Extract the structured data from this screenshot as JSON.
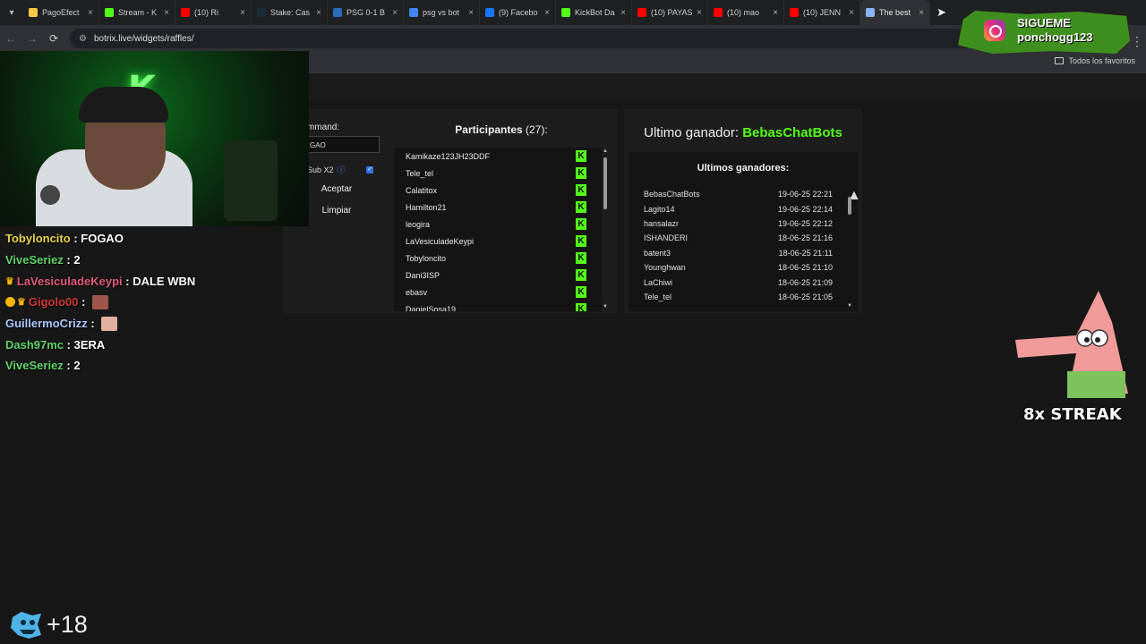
{
  "browser": {
    "tabs": [
      {
        "title": "PagoEfect",
        "color": "#f7c948"
      },
      {
        "title": "Stream - K",
        "color": "#53fc18"
      },
      {
        "title": "(10) Ri",
        "color": "#ff0000"
      },
      {
        "title": "Stake: Cas",
        "color": "#1a2c38"
      },
      {
        "title": "PSG 0-1 B",
        "color": "#2a6ebb"
      },
      {
        "title": "psg vs bot",
        "color": "#4285f4"
      },
      {
        "title": "(9) Facebo",
        "color": "#1877f2"
      },
      {
        "title": "KickBot Da",
        "color": "#53fc18"
      },
      {
        "title": "(10) PAYAS",
        "color": "#ff0000"
      },
      {
        "title": "(10) mao",
        "color": "#ff0000"
      },
      {
        "title": "(10) JENN",
        "color": "#ff0000"
      },
      {
        "title": "The best",
        "color": "#8ab4f8",
        "active": true
      }
    ],
    "url": "botrix.live/widgets/raffles/",
    "bookmarks_all": "Todos los favoritos"
  },
  "raffle": {
    "command_label": "mmand:",
    "command_value": "GAO",
    "sub_label": "Sub X2",
    "accept_label": "Aceptar",
    "clear_label": "Limpiar",
    "participants_title": "Participantes",
    "participants_count": "(27):",
    "participants": [
      "Kamikaze123JH23DDF",
      "Tele_tel",
      "Calatitox",
      "Hamilton21",
      "leogira",
      "LaVesiculadeKeypi",
      "Tobyloncito",
      "Dani3ISP",
      "ebasv",
      "DanielSosa19"
    ],
    "last_winner_prefix": "Ultimo ganador:",
    "last_winner_name": "BebasChatBots",
    "winners_title": "Ultimos ganadores:",
    "winners": [
      {
        "name": "BebasChatBots",
        "date": "19-06-25 22:21"
      },
      {
        "name": "Lagito14",
        "date": "19-06-25 22:14"
      },
      {
        "name": "hansalazr",
        "date": "19-06-25 22:12"
      },
      {
        "name": "ISHANDERI",
        "date": "18-06-25 21:16"
      },
      {
        "name": "batent3",
        "date": "18-06-25 21:11"
      },
      {
        "name": "Younghwan",
        "date": "18-06-25 21:10"
      },
      {
        "name": "LaChiwi",
        "date": "18-06-25 21:09"
      },
      {
        "name": "Tele_tel",
        "date": "18-06-25 21:05"
      }
    ]
  },
  "chat": [
    {
      "user": "Tobyloncito",
      "color": "#e8d44d",
      "message": "FOGAO"
    },
    {
      "user": "ViveSeriez",
      "color": "#5fd36a",
      "message": "2"
    },
    {
      "user": "LaVesiculadeKeypi",
      "color": "#e05a7a",
      "message": "DALE WBN",
      "crown": true
    },
    {
      "user": "Gigolo00",
      "color": "#d03a3a",
      "message": "",
      "crown": true,
      "badge": true,
      "emote": "#a0554a"
    },
    {
      "user": "GuillermoCrizz",
      "color": "#a9c8ff",
      "message": "",
      "emote": "#e0b0a0"
    },
    {
      "user": "Dash97mc",
      "color": "#5fd36a",
      "message": "3ERA"
    },
    {
      "user": "ViveSeriez",
      "color": "#5fd36a",
      "message": "2"
    }
  ],
  "overlay": {
    "follow_heading": "SIGUEME",
    "follow_user": "ponchogg123",
    "streak": "8x STREAK",
    "corner_count": "+18"
  },
  "colors": {
    "kick_green": "#53fc18",
    "background": "#171717"
  }
}
